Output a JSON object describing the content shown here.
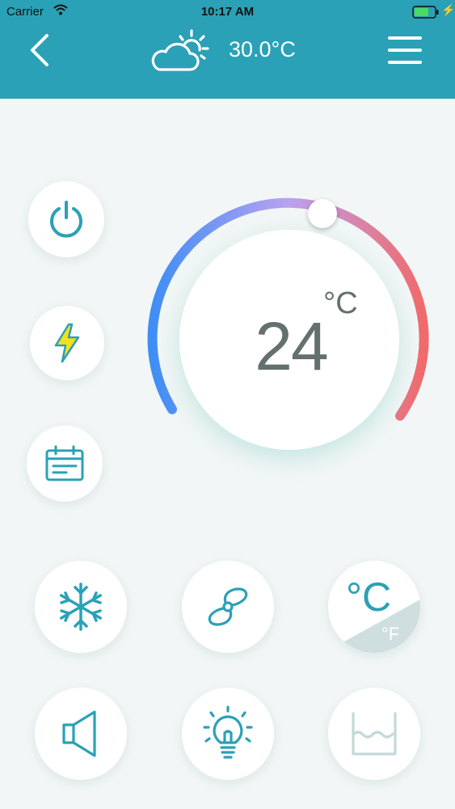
{
  "status_bar": {
    "carrier": "Carrier",
    "time": "10:17 AM"
  },
  "header": {
    "outdoor_temp": "30.0°C",
    "weather_icon": "partly-cloudy-icon"
  },
  "thermostat": {
    "set_temperature": "24",
    "unit": "°C",
    "level": 0.55
  },
  "buttons": {
    "power": "power-icon",
    "eco": "lightning-icon",
    "schedule": "calendar-icon",
    "cool_mode": "snowflake-icon",
    "fan": "fan-icon",
    "unit_toggle": {
      "primary": "°C",
      "secondary": "°F"
    },
    "sound": "speaker-icon",
    "light": "bulb-icon",
    "humidity": "water-level-icon"
  },
  "colors": {
    "header": "#2aa1b6",
    "accent": "#2aa1b6",
    "gauge_cold": "#3f8ef5",
    "gauge_mid": "#b9a2f0",
    "gauge_hot": "#f26a6a"
  }
}
